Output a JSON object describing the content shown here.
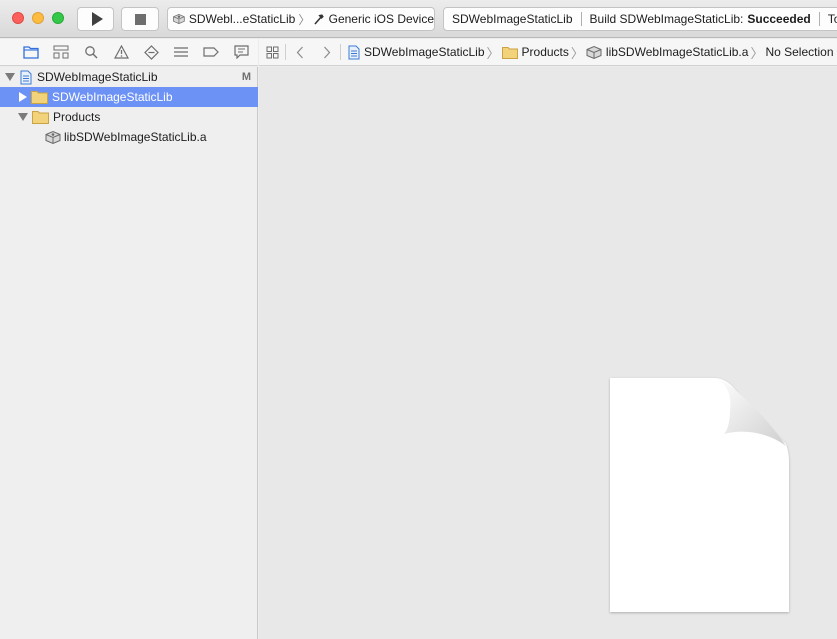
{
  "toolbar": {
    "scheme_name": "SDWebl...eStaticLib",
    "scheme_sep": "〉",
    "destination": "Generic iOS Device",
    "activity_project": "SDWebImageStaticLib",
    "activity_status_prefix": "Build SDWebImageStaticLib:",
    "activity_status_result": "Succeeded",
    "activity_time": "Toda"
  },
  "navigator_tabs": [
    {
      "icon": "folder-icon"
    },
    {
      "icon": "symbol-hierarchy-icon"
    },
    {
      "icon": "search-icon"
    },
    {
      "icon": "warning-icon"
    },
    {
      "icon": "test-diamond-icon"
    },
    {
      "icon": "debug-list-icon"
    },
    {
      "icon": "breakpoint-icon"
    },
    {
      "icon": "report-bubble-icon"
    }
  ],
  "jump_bar": {
    "crumbs": [
      {
        "label": "SDWebImageStaticLib",
        "icon": "project-file-icon"
      },
      {
        "label": "Products",
        "icon": "folder-icon"
      },
      {
        "label": "libSDWebImageStaticLib.a",
        "icon": "library-icon"
      },
      {
        "label": "No Selection"
      }
    ],
    "chevron": "〉"
  },
  "tree": [
    {
      "label": "SDWebImageStaticLib",
      "badge": "M",
      "icon": "project-file-icon",
      "expanded": true,
      "level": 0
    },
    {
      "label": "SDWebImageStaticLib",
      "icon": "folder-icon",
      "expanded": false,
      "level": 1,
      "selected": true
    },
    {
      "label": "Products",
      "icon": "folder-icon",
      "expanded": true,
      "level": 1
    },
    {
      "label": "libSDWebImageStaticLib.a",
      "icon": "library-icon",
      "level": 2
    }
  ],
  "colors": {
    "selection": "#6d92f6",
    "folder": "#f2d27a",
    "accent_blue": "#3a7bd5"
  }
}
